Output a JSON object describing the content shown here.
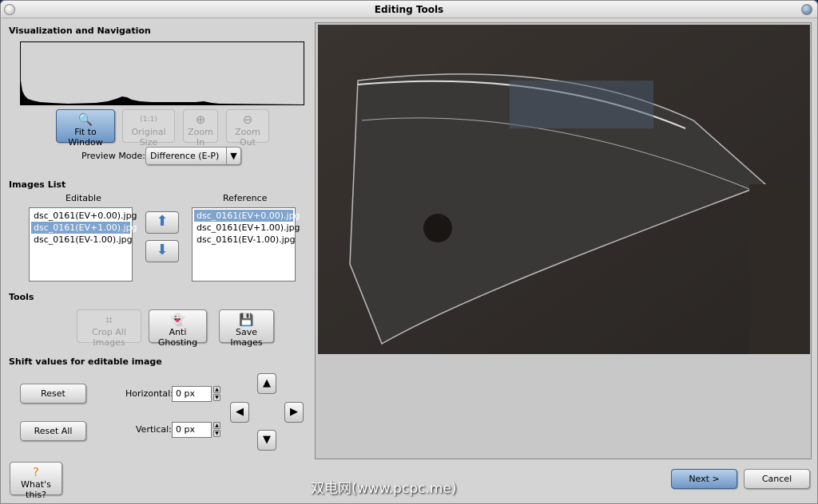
{
  "window": {
    "title": "Editing Tools"
  },
  "visualization": {
    "heading": "Visualization and Navigation",
    "buttons": {
      "fit": "Fit to Window",
      "original": "Original Size",
      "zoom_in": "Zoom In",
      "zoom_out": "Zoom Out"
    },
    "preview_mode_label": "Preview Mode:",
    "preview_mode_value": "Difference (E-P)"
  },
  "images_list": {
    "heading": "Images List",
    "editable_label": "Editable",
    "reference_label": "Reference",
    "editable": [
      "dsc_0161(EV+0.00).jpg",
      "dsc_0161(EV+1.00).jpg",
      "dsc_0161(EV-1.00).jpg"
    ],
    "reference": [
      "dsc_0161(EV+0.00).jpg",
      "dsc_0161(EV+1.00).jpg",
      "dsc_0161(EV-1.00).jpg"
    ]
  },
  "tools": {
    "heading": "Tools",
    "crop": "Crop All Images",
    "anti_ghosting": "Anti Ghosting",
    "save": "Save Images"
  },
  "shift": {
    "heading": "Shift values for editable image",
    "reset": "Reset",
    "reset_all": "Reset All",
    "horizontal_label": "Horizontal:",
    "horizontal_value": "0 px",
    "vertical_label": "Vertical:",
    "vertical_value": "0 px"
  },
  "footer": {
    "whats_this": "What's this?",
    "next": "Next >",
    "cancel": "Cancel",
    "watermark": "双电网(www.pcpc.me)"
  }
}
